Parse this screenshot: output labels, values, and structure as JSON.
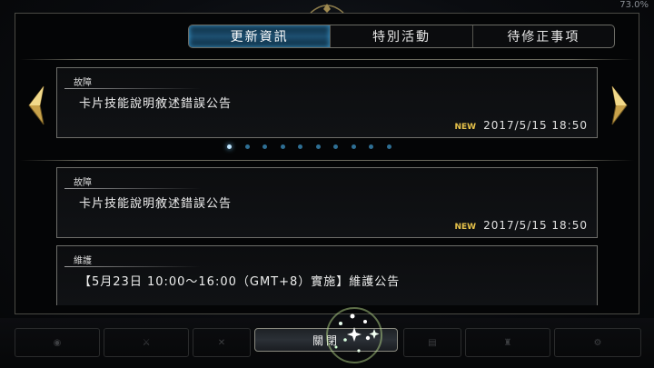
{
  "status": {
    "text": "73.0%"
  },
  "tabs": [
    {
      "label": "更新資訊",
      "active": true
    },
    {
      "label": "特別活動",
      "active": false
    },
    {
      "label": "待修正事項",
      "active": false
    }
  ],
  "carousel": {
    "card": {
      "category": "故障",
      "title": "卡片技能說明敘述錯誤公告",
      "new_badge": "NEW",
      "date": "2017/5/15  18:50"
    },
    "page_count": 10,
    "active_page": 1
  },
  "list": [
    {
      "category": "故障",
      "title": "卡片技能說明敘述錯誤公告",
      "new_badge": "NEW",
      "date": "2017/5/15  18:50"
    },
    {
      "category": "維護",
      "title": "【5月23日 10:00～16:00（GMT+8）實施】維護公告"
    }
  ],
  "close_button": {
    "label": "關閉"
  },
  "colors": {
    "accent_blue": "#1d4f70",
    "new_badge": "#e6c24a",
    "border": "#6e6e6a"
  }
}
